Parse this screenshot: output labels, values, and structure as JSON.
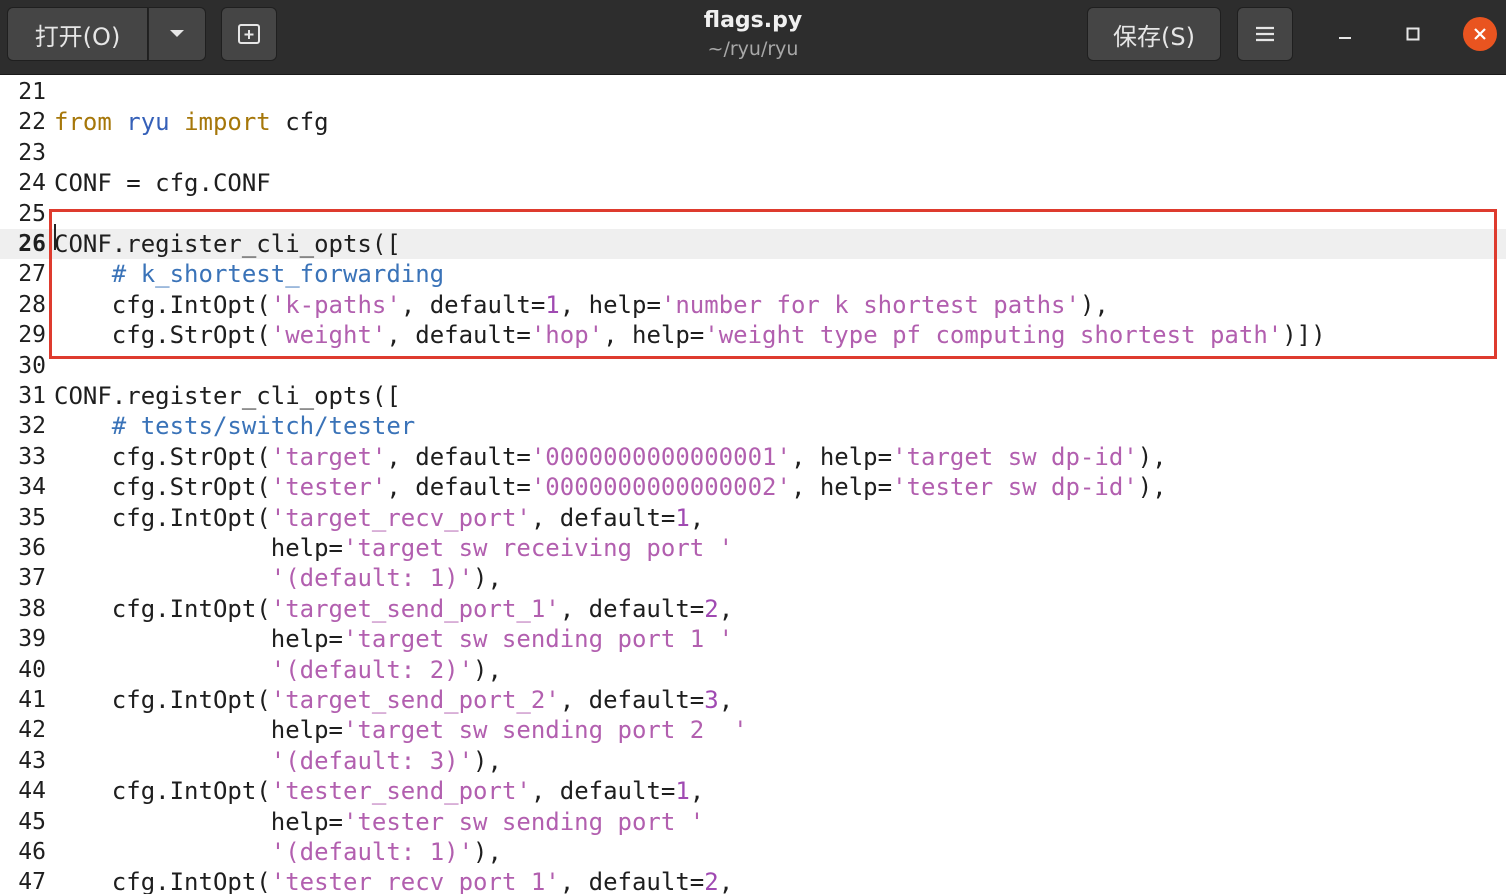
{
  "window": {
    "title": "flags.py",
    "subtitle": "~/ryu/ryu",
    "open_label": "打开(O)",
    "save_label": "保存(S)"
  },
  "colors": {
    "titlebar": "#2d2d2d",
    "close_button": "#e95420",
    "highlight_border": "#de3b2e",
    "keyword": "#a6770a",
    "string": "#b25faf",
    "comment": "#3a73b8"
  },
  "icons": {
    "dropdown": "chevron-down-icon",
    "new_tab": "new-tab-icon",
    "menu": "hamburger-menu-icon",
    "minimize": "minimize-icon",
    "maximize": "maximize-icon",
    "close": "close-icon"
  },
  "editor": {
    "current_line": 26,
    "highlighted_lines": [
      26,
      30
    ],
    "lines": [
      {
        "n": "21",
        "tokens": []
      },
      {
        "n": "22",
        "tokens": [
          [
            "kw",
            "from"
          ],
          [
            "t",
            " "
          ],
          [
            "id",
            "ryu"
          ],
          [
            "t",
            " "
          ],
          [
            "kw",
            "import"
          ],
          [
            "t",
            " cfg"
          ]
        ]
      },
      {
        "n": "23",
        "tokens": []
      },
      {
        "n": "24",
        "tokens": [
          [
            "t",
            "CONF = cfg.CONF"
          ]
        ]
      },
      {
        "n": "25",
        "tokens": []
      },
      {
        "n": "26",
        "tokens": [
          [
            "t",
            "CONF.register_cli_opts(["
          ]
        ]
      },
      {
        "n": "27",
        "tokens": [
          [
            "t",
            "    "
          ],
          [
            "cmt",
            "# k_shortest_forwarding"
          ]
        ]
      },
      {
        "n": "28",
        "tokens": [
          [
            "t",
            "    cfg.IntOpt("
          ],
          [
            "str",
            "'k-paths'"
          ],
          [
            "t",
            ", default="
          ],
          [
            "num",
            "1"
          ],
          [
            "t",
            ", help="
          ],
          [
            "str",
            "'number for k shortest paths'"
          ],
          [
            "t",
            "),"
          ]
        ]
      },
      {
        "n": "29",
        "tokens": [
          [
            "t",
            "    cfg.StrOpt("
          ],
          [
            "str",
            "'weight'"
          ],
          [
            "t",
            ", default="
          ],
          [
            "str",
            "'hop'"
          ],
          [
            "t",
            ", help="
          ],
          [
            "str",
            "'weight type pf computing shortest path'"
          ],
          [
            "t",
            ")])"
          ]
        ]
      },
      {
        "n": "30",
        "tokens": []
      },
      {
        "n": "31",
        "tokens": [
          [
            "t",
            "CONF.register_cli_opts(["
          ]
        ]
      },
      {
        "n": "32",
        "tokens": [
          [
            "t",
            "    "
          ],
          [
            "cmt",
            "# tests/switch/tester"
          ]
        ]
      },
      {
        "n": "33",
        "tokens": [
          [
            "t",
            "    cfg.StrOpt("
          ],
          [
            "str",
            "'target'"
          ],
          [
            "t",
            ", default="
          ],
          [
            "str",
            "'0000000000000001'"
          ],
          [
            "t",
            ", help="
          ],
          [
            "str",
            "'target sw dp-id'"
          ],
          [
            "t",
            "),"
          ]
        ]
      },
      {
        "n": "34",
        "tokens": [
          [
            "t",
            "    cfg.StrOpt("
          ],
          [
            "str",
            "'tester'"
          ],
          [
            "t",
            ", default="
          ],
          [
            "str",
            "'0000000000000002'"
          ],
          [
            "t",
            ", help="
          ],
          [
            "str",
            "'tester sw dp-id'"
          ],
          [
            "t",
            "),"
          ]
        ]
      },
      {
        "n": "35",
        "tokens": [
          [
            "t",
            "    cfg.IntOpt("
          ],
          [
            "str",
            "'target_recv_port'"
          ],
          [
            "t",
            ", default="
          ],
          [
            "num",
            "1"
          ],
          [
            "t",
            ","
          ]
        ]
      },
      {
        "n": "36",
        "tokens": [
          [
            "t",
            "               help="
          ],
          [
            "str",
            "'target sw receiving port '"
          ]
        ]
      },
      {
        "n": "37",
        "tokens": [
          [
            "t",
            "               "
          ],
          [
            "str",
            "'(default: 1)'"
          ],
          [
            "t",
            "),"
          ]
        ]
      },
      {
        "n": "38",
        "tokens": [
          [
            "t",
            "    cfg.IntOpt("
          ],
          [
            "str",
            "'target_send_port_1'"
          ],
          [
            "t",
            ", default="
          ],
          [
            "num",
            "2"
          ],
          [
            "t",
            ","
          ]
        ]
      },
      {
        "n": "39",
        "tokens": [
          [
            "t",
            "               help="
          ],
          [
            "str",
            "'target sw sending port 1 '"
          ]
        ]
      },
      {
        "n": "40",
        "tokens": [
          [
            "t",
            "               "
          ],
          [
            "str",
            "'(default: 2)'"
          ],
          [
            "t",
            "),"
          ]
        ]
      },
      {
        "n": "41",
        "tokens": [
          [
            "t",
            "    cfg.IntOpt("
          ],
          [
            "str",
            "'target_send_port_2'"
          ],
          [
            "t",
            ", default="
          ],
          [
            "num",
            "3"
          ],
          [
            "t",
            ","
          ]
        ]
      },
      {
        "n": "42",
        "tokens": [
          [
            "t",
            "               help="
          ],
          [
            "str",
            "'target sw sending port 2  '"
          ]
        ]
      },
      {
        "n": "43",
        "tokens": [
          [
            "t",
            "               "
          ],
          [
            "str",
            "'(default: 3)'"
          ],
          [
            "t",
            "),"
          ]
        ]
      },
      {
        "n": "44",
        "tokens": [
          [
            "t",
            "    cfg.IntOpt("
          ],
          [
            "str",
            "'tester_send_port'"
          ],
          [
            "t",
            ", default="
          ],
          [
            "num",
            "1"
          ],
          [
            "t",
            ","
          ]
        ]
      },
      {
        "n": "45",
        "tokens": [
          [
            "t",
            "               help="
          ],
          [
            "str",
            "'tester sw sending port '"
          ]
        ]
      },
      {
        "n": "46",
        "tokens": [
          [
            "t",
            "               "
          ],
          [
            "str",
            "'(default: 1)'"
          ],
          [
            "t",
            "),"
          ]
        ]
      },
      {
        "n": "47",
        "tokens": [
          [
            "t",
            "    cfg.IntOpt("
          ],
          [
            "str",
            "'tester_recv_port_1'"
          ],
          [
            "t",
            ", default="
          ],
          [
            "num",
            "2"
          ],
          [
            "t",
            ","
          ]
        ]
      }
    ]
  }
}
